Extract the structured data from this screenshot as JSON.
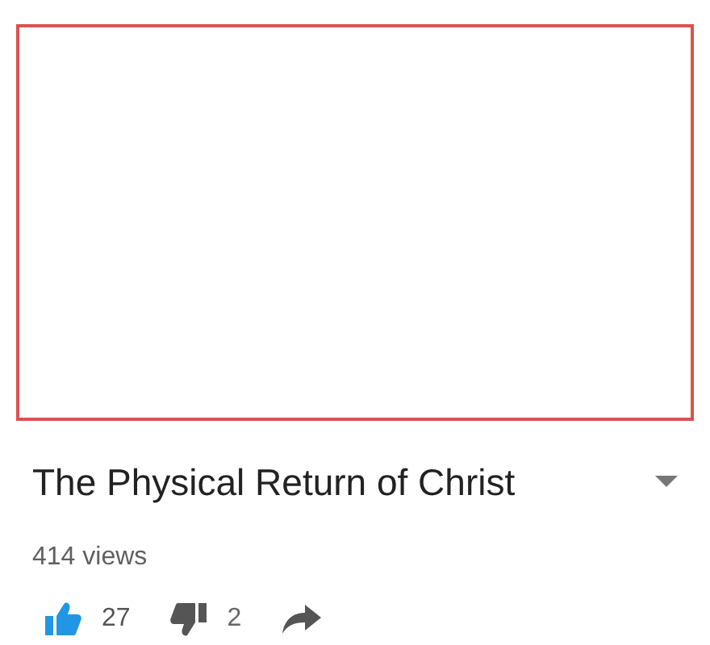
{
  "video": {
    "title": "The Physical Return of Christ",
    "views": "414 views",
    "expanded": false
  },
  "actions": [
    {
      "kind": "like",
      "count": "27",
      "selected": true
    },
    {
      "kind": "dislike",
      "count": "2",
      "selected": false
    },
    {
      "kind": "share"
    }
  ]
}
